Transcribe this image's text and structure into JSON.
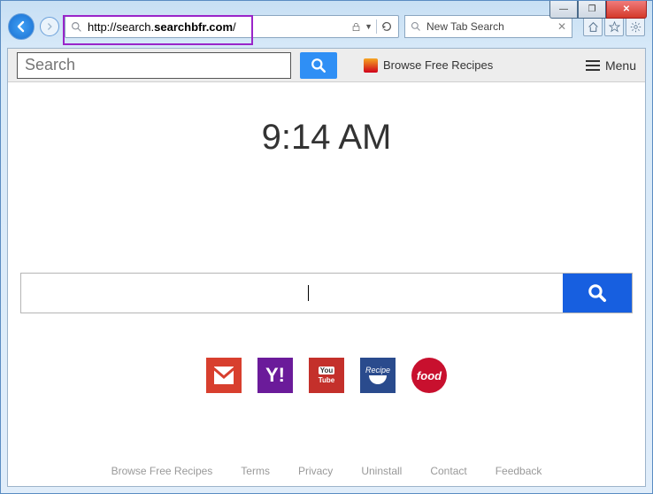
{
  "window": {
    "buttons": {
      "min": "—",
      "max": "❐",
      "close": "✕"
    }
  },
  "nav": {
    "url_prefix": "http://search.",
    "url_host": "searchbfr.com",
    "url_suffix": "/",
    "tab_title": "New Tab Search"
  },
  "toolbar": {
    "search_placeholder": "Search",
    "recipes_label": "Browse Free Recipes",
    "menu_label": "Menu"
  },
  "clock": "9:14 AM",
  "main_search": {
    "value": ""
  },
  "tiles": [
    {
      "name": "gmail",
      "label": "M"
    },
    {
      "name": "yahoo",
      "label": "Y!"
    },
    {
      "name": "youtube",
      "label_top": "You",
      "label_bot": "Tube"
    },
    {
      "name": "recipe",
      "label": "Recipe"
    },
    {
      "name": "food",
      "label": "food"
    }
  ],
  "footer": {
    "links": [
      "Browse Free Recipes",
      "Terms",
      "Privacy",
      "Uninstall",
      "Contact",
      "Feedback"
    ]
  }
}
